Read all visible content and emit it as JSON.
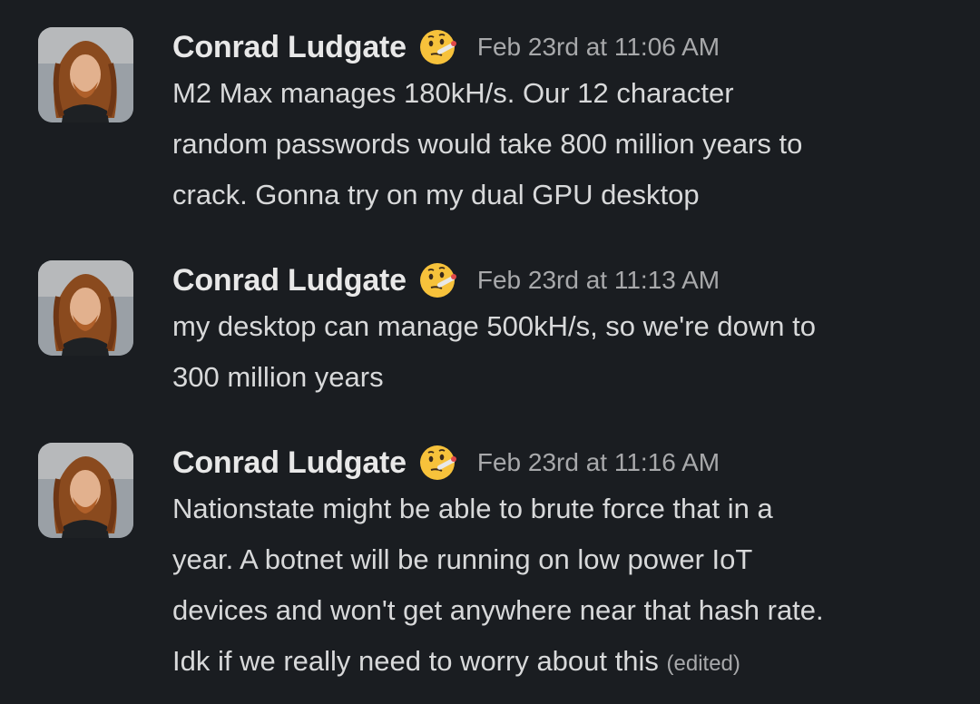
{
  "messages": [
    {
      "author": "Conrad Ludgate",
      "status_emoji": "face-with-thermometer-icon",
      "timestamp": "Feb 23rd at 11:06 AM",
      "lines": [
        "M2 Max manages 180kH/s. Our 12 character",
        "random passwords would take 800 million years to",
        "crack. Gonna try on my dual GPU desktop"
      ],
      "edited": ""
    },
    {
      "author": "Conrad Ludgate",
      "status_emoji": "face-with-thermometer-icon",
      "timestamp": "Feb 23rd at 11:13 AM",
      "lines": [
        "my desktop can manage 500kH/s, so we're down to",
        "300 million years"
      ],
      "edited": ""
    },
    {
      "author": "Conrad Ludgate",
      "status_emoji": "face-with-thermometer-icon",
      "timestamp": "Feb 23rd at 11:16 AM",
      "lines": [
        "Nationstate might be able to brute force that in a",
        "year. A botnet will be running on low power IoT",
        "devices and won't get anywhere near that hash rate.",
        "Idk if we really need to worry about this"
      ],
      "edited": "(edited)"
    }
  ],
  "colors": {
    "background": "#1a1d21",
    "author": "#e8e8e8",
    "body": "#d8d9da",
    "timestamp": "#a8a9ab"
  }
}
